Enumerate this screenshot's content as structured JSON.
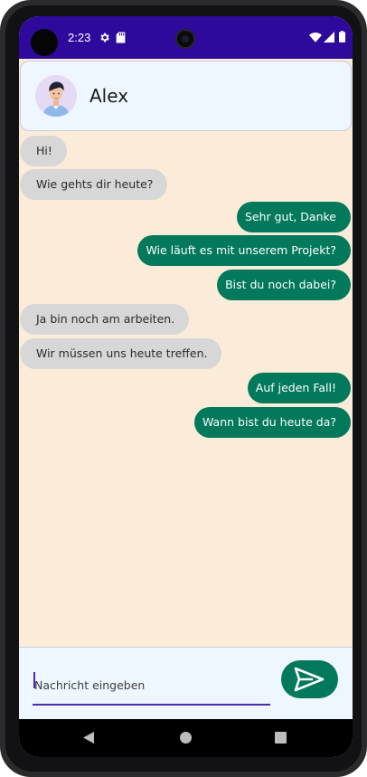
{
  "status_bar": {
    "time": "2:23",
    "icons": [
      "gear-icon",
      "sdcard-icon",
      "wifi-icon",
      "signal-icon",
      "battery-icon"
    ]
  },
  "header": {
    "contact_name": "Alex",
    "avatar_icon": "avatar-icon"
  },
  "messages": [
    {
      "direction": "in",
      "text": "Hi!"
    },
    {
      "direction": "in",
      "text": "Wie gehts dir heute?"
    },
    {
      "direction": "out",
      "text": "Sehr gut, Danke"
    },
    {
      "direction": "out",
      "text": "Wie läuft es mit unserem Projekt?"
    },
    {
      "direction": "out",
      "text": "Bist du noch dabei?"
    },
    {
      "direction": "in",
      "text": "Ja bin noch am arbeiten."
    },
    {
      "direction": "in",
      "text": "Wir müssen uns heute treffen."
    },
    {
      "direction": "out",
      "text": "Auf jeden Fall!"
    },
    {
      "direction": "out",
      "text": "Wann bist du heute da?"
    }
  ],
  "composer": {
    "value": "",
    "placeholder": "Nachricht eingeben",
    "send_icon": "send-icon"
  },
  "nav_bar": {
    "icons": [
      "back-icon",
      "home-icon",
      "recents-icon"
    ]
  },
  "colors": {
    "status_bar": "#2e0a9c",
    "chat_background": "#fbecd9",
    "incoming_bubble": "#d7d7d8",
    "outgoing_bubble": "#03795c",
    "input_underline": "#4b2bb0",
    "header_background": "#eef6ff"
  }
}
